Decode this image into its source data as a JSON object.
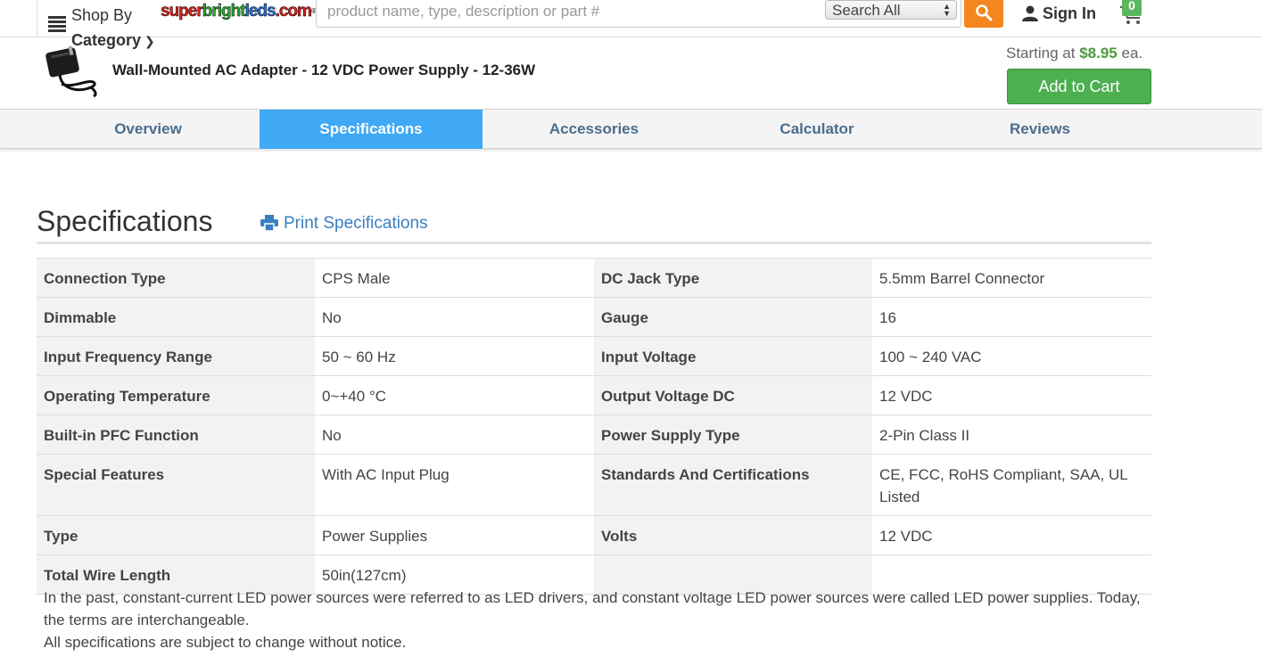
{
  "header": {
    "shop_by_line1": "Shop By",
    "shop_by_line2": "Category",
    "logo": {
      "part1": "super",
      "part2": "bright",
      "part3": "leds",
      "part4": ".com"
    },
    "search_placeholder": "product name, type, description or part #",
    "search_scope": "Search All",
    "sign_in": "Sign In",
    "cart_count": "0"
  },
  "product": {
    "title": "Wall-Mounted AC Adapter - 12 VDC Power Supply - 12-36W",
    "price_prefix": "Starting at ",
    "price": "$8.95",
    "price_suffix": " ea.",
    "add_to_cart": "Add to Cart"
  },
  "tabs": [
    {
      "label": "Overview"
    },
    {
      "label": "Specifications"
    },
    {
      "label": "Accessories"
    },
    {
      "label": "Calculator"
    },
    {
      "label": "Reviews"
    }
  ],
  "specs": {
    "heading": "Specifications",
    "print_link": "Print Specifications",
    "rows": [
      [
        "Connection Type",
        "CPS Male",
        "DC Jack Type",
        "5.5mm Barrel Connector"
      ],
      [
        "Dimmable",
        "No",
        "Gauge",
        "16"
      ],
      [
        "Input Frequency Range",
        "50 ~ 60 Hz",
        "Input Voltage",
        "100 ~ 240 VAC"
      ],
      [
        "Operating Temperature",
        "0~+40 °C",
        "Output Voltage DC",
        "12 VDC"
      ],
      [
        "Built-in PFC Function",
        "No",
        "Power Supply Type",
        "2-Pin Class II"
      ],
      [
        "Special Features",
        "With AC Input Plug",
        "Standards And Certifications",
        "CE, FCC, RoHS Compliant, SAA, UL Listed"
      ],
      [
        "Type",
        "Power Supplies",
        "Volts",
        "12 VDC"
      ],
      [
        "Total Wire Length",
        "50in(127cm)",
        "",
        ""
      ]
    ],
    "note_line1": "In the past, constant-current LED power sources were referred to as LED drivers, and constant voltage LED power sources were called LED power supplies. Today, the terms are interchangeable.",
    "note_line2": "All specifications are subject to change without notice."
  },
  "colors": {
    "accent_tab": "#3fa9f5",
    "search_button": "#f5861f",
    "add_to_cart": "#4caf50",
    "price": "#4a9a3e",
    "link": "#3a7fc1"
  },
  "icons": [
    "hamburger-icon",
    "search-icon",
    "user-icon",
    "cart-icon",
    "printer-icon",
    "chevron-down-icon"
  ]
}
